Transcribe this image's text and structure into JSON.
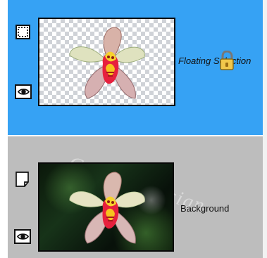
{
  "watermark": {
    "text": "CreativeDesign"
  },
  "layers": [
    {
      "label": "Floating Selection",
      "selected": true,
      "visible": true,
      "locked": true,
      "icon": "selection-icon",
      "thumbnail": "transparent-orchid-thumbnail"
    },
    {
      "label": "Background",
      "selected": false,
      "visible": true,
      "locked": false,
      "icon": "raster-layer-icon",
      "thumbnail": "orchid-background-thumbnail"
    }
  ],
  "colors": {
    "selected_layer": "#36a2f4",
    "unselected_layer": "#bdbdbd",
    "lock": "#f2c84b"
  }
}
